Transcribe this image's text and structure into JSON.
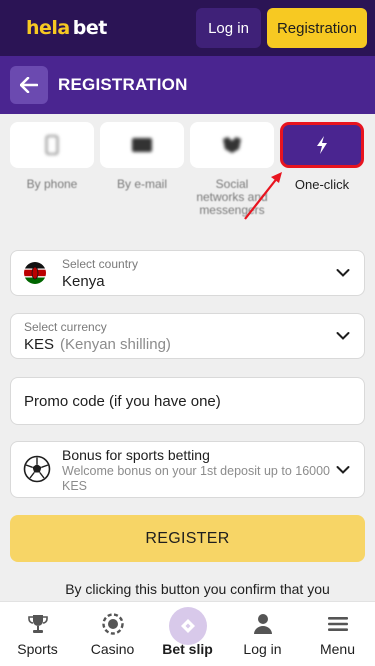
{
  "header": {
    "logo_part1": "hela",
    "logo_part2": "bet",
    "login_label": "Log in",
    "registration_label": "Registration"
  },
  "titlebar": {
    "title": "REGISTRATION"
  },
  "methods": [
    {
      "label": "By phone",
      "icon": "phone-icon"
    },
    {
      "label": "By e-mail",
      "icon": "email-icon"
    },
    {
      "label": "Social networks and messengers",
      "icon": "social-icon"
    },
    {
      "label": "One-click",
      "icon": "lightning-icon",
      "active": true
    }
  ],
  "country": {
    "label": "Select country",
    "value": "Kenya"
  },
  "currency": {
    "label": "Select currency",
    "code": "KES",
    "name": "(Kenyan shilling)"
  },
  "promo": {
    "placeholder": "Promo code (if you have one)"
  },
  "bonus": {
    "title": "Bonus for sports betting",
    "description": "Welcome bonus on your 1st deposit up to 16000 KES"
  },
  "register_button": "REGISTER",
  "consent_text": "By clicking this button you confirm that you",
  "bottom_nav": [
    {
      "label": "Sports",
      "icon": "trophy-icon"
    },
    {
      "label": "Casino",
      "icon": "chip-icon"
    },
    {
      "label": "Bet slip",
      "icon": "ticket-icon"
    },
    {
      "label": "Log in",
      "icon": "user-icon"
    },
    {
      "label": "Menu",
      "icon": "menu-icon"
    }
  ],
  "colors": {
    "brand_dark": "#2b1455",
    "brand_purple": "#4a2590",
    "accent_yellow": "#f7c922",
    "highlight_red": "#e8141f"
  }
}
